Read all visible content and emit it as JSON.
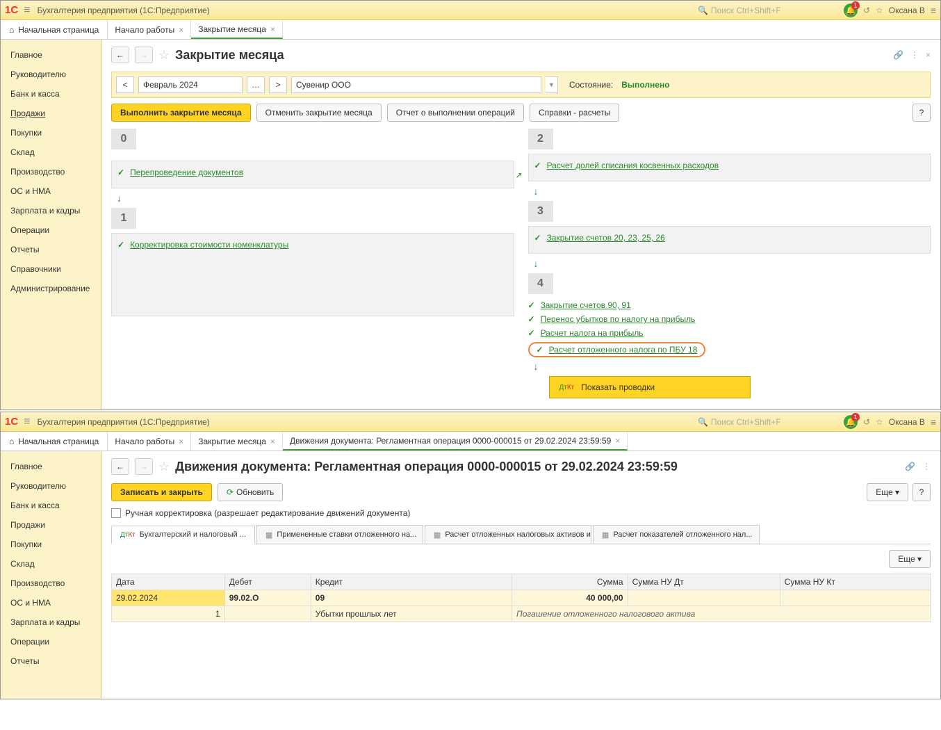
{
  "app": {
    "title": "Бухгалтерия предприятия  (1С:Предприятие)",
    "search_placeholder": "Поиск Ctrl+Shift+F",
    "user": "Оксана В",
    "notification_count": "1"
  },
  "tabs_top": {
    "home": "Начальная страница",
    "t1": "Начало работы",
    "t2": "Закрытие месяца"
  },
  "sidebar": {
    "items": [
      "Главное",
      "Руководителю",
      "Банк и касса",
      "Продажи",
      "Покупки",
      "Склад",
      "Производство",
      "ОС и НМА",
      "Зарплата и кадры",
      "Операции",
      "Отчеты",
      "Справочники",
      "Администрирование"
    ],
    "active_index_top": 3
  },
  "page1": {
    "title": "Закрытие месяца",
    "period": "Февраль 2024",
    "org": "Сувенир ООО",
    "status_label": "Состояние:",
    "status_value": "Выполнено",
    "actions": {
      "run": "Выполнить закрытие месяца",
      "cancel": "Отменить закрытие месяца",
      "report": "Отчет о выполнении операций",
      "refs": "Справки - расчеты",
      "help": "?"
    },
    "stages": {
      "s0": {
        "num": "0",
        "ops": [
          "Перепроведение документов"
        ]
      },
      "s1": {
        "num": "1",
        "ops": [
          "Корректировка стоимости номенклатуры"
        ]
      },
      "s2": {
        "num": "2",
        "ops": [
          "Расчет долей списания косвенных расходов"
        ]
      },
      "s3": {
        "num": "3",
        "ops": [
          "Закрытие счетов 20, 23, 25, 26"
        ]
      },
      "s4": {
        "num": "4",
        "ops": [
          "Закрытие счетов 90, 91",
          "Перенос убытков по налогу на прибыль",
          "Расчет налога на прибыль",
          "Расчет отложенного налога по ПБУ 18"
        ]
      }
    },
    "context_menu": "Показать проводки"
  },
  "tabs_bottom": {
    "home": "Начальная страница",
    "t1": "Начало работы",
    "t2": "Закрытие месяца",
    "t3": "Движения документа: Регламентная операция 0000-000015 от 29.02.2024 23:59:59"
  },
  "page2": {
    "title": "Движения документа: Регламентная операция 0000-000015 от 29.02.2024 23:59:59",
    "actions": {
      "save": "Записать и закрыть",
      "refresh": "Обновить",
      "more": "Еще",
      "help": "?"
    },
    "manual_edit": "Ручная корректировка (разрешает редактирование движений документа)",
    "subtabs": [
      "Бухгалтерский и налоговый ...",
      "Примененные ставки отложенного на...",
      "Расчет отложенных налоговых активов и обязате...",
      "Расчет показателей отложенного нал..."
    ],
    "grid": {
      "headers": {
        "date": "Дата",
        "debit": "Дебет",
        "credit": "Кредит",
        "sum": "Сумма",
        "sum_nu_dt": "Сумма НУ Дт",
        "sum_nu_kt": "Сумма НУ Кт"
      },
      "rows": [
        {
          "date": "29.02.2024",
          "num": "1",
          "debit": "99.02.О",
          "credit": "09",
          "credit_desc": "Убытки прошлых лет",
          "sum": "40 000,00",
          "desc": "Погашение отложенного налогового актива"
        }
      ]
    }
  },
  "sidebar2_cut": [
    "Главное",
    "Руководителю",
    "Банк и касса",
    "Продажи",
    "Покупки",
    "Склад",
    "Производство",
    "ОС и НМА",
    "Зарплата и кадры",
    "Операции",
    "Отчеты"
  ]
}
